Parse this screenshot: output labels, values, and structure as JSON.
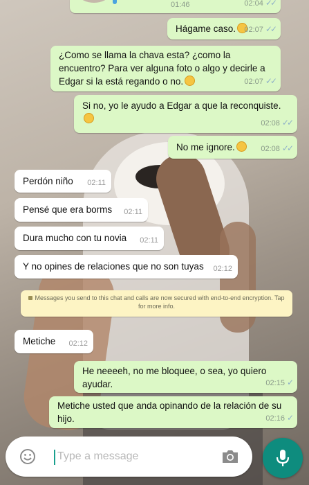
{
  "messages": [
    {
      "text": "",
      "time": "02:04",
      "has_emoji": false
    },
    {
      "text": "Hágame caso.",
      "time": "02:07"
    },
    {
      "text": "¿Como se llama la chava esta? ¿como la encuentro? Para ver alguna foto o algo y decirle a Edgar si la está regando o no.",
      "time": "02:07"
    },
    {
      "text": "Si no, yo le ayudo a Edgar a que la reconquiste.",
      "time": "02:08"
    },
    {
      "text": "No me ignore.",
      "time": "02:08"
    },
    {
      "text": "Perdón niño",
      "time": "02:11"
    },
    {
      "text": "Pensé que era borms",
      "time": "02:11"
    },
    {
      "text": "Dura mucho con tu novia",
      "time": "02:11"
    },
    {
      "text": "Y no opines de relaciones que no son tuyas",
      "time": "02:12"
    },
    {
      "text": "Metiche",
      "time": "02:12"
    },
    {
      "text": "He neeeeh, no me bloquee, o sea, yo quiero ayudar.",
      "time": "02:15"
    },
    {
      "text": "Metiche usted que anda opinando de la relación de su hijo.",
      "time": "02:16"
    }
  ],
  "audio_message": {
    "duration": "01:46",
    "time": "02:04"
  },
  "system_notice": "Messages you send to this chat and calls are now secured with end-to-end encryption. Tap for more info.",
  "composer": {
    "placeholder": "Type a message"
  },
  "icons": {
    "emoji": "smiley-icon",
    "attach_camera": "camera-icon",
    "record": "microphone-icon",
    "read_receipt": "double-check-icon"
  },
  "colors": {
    "outgoing_bubble": "#dcf8c6",
    "incoming_bubble": "#ffffff",
    "notice_bubble": "#fdf4c4",
    "mic_button": "#0e8c7e",
    "read_ticks": "#8fb1c8"
  }
}
